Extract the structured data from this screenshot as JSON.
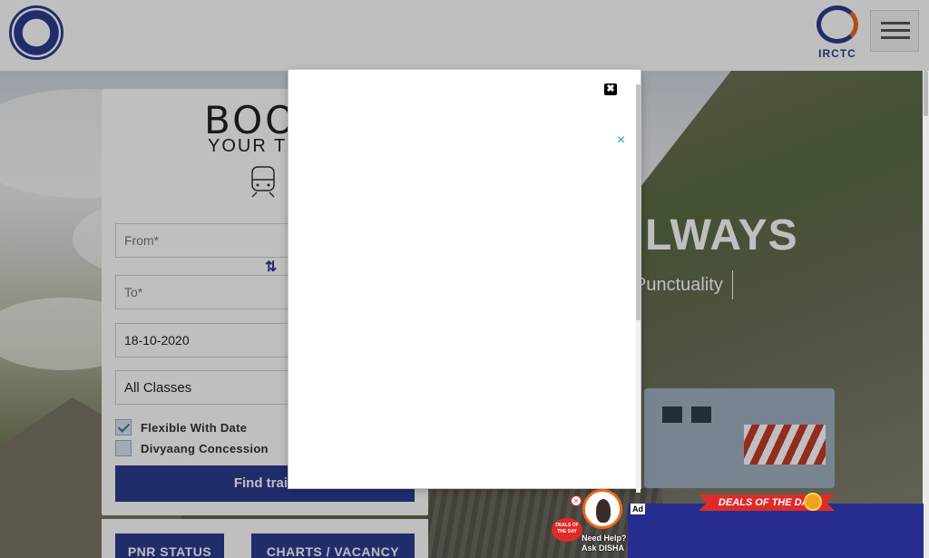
{
  "header": {
    "left_logo": "indian-railways-logo",
    "right_logo_text": "IRCTC",
    "menu_icon": "hamburger-icon"
  },
  "hero": {
    "title_partial": "LWAYS",
    "subtitle_partial": "Punctuality"
  },
  "booking": {
    "title_partial": "BOO",
    "subtitle_partial": "YOUR TIC",
    "from_placeholder": "From*",
    "to_placeholder": "To*",
    "swap_icon": "⇅",
    "date_value": "18-10-2020",
    "class_value": "All Classes",
    "flexible_label": "Flexible With Date",
    "flexible_checked": true,
    "divyaang_label": "Divyaang Concession",
    "divyaang_checked": false,
    "find_button_partial": "Find train"
  },
  "bottom_buttons": {
    "pnr": "PNR STATUS",
    "charts": "CHARTS / VACANCY"
  },
  "modal": {
    "close_glyph": "✖",
    "ad_close_glyph": "×"
  },
  "ad": {
    "tag": "Ad",
    "deals_title": "DEALS OF THE DAY",
    "deals_badge_text": "DEALS OF THE DAY",
    "disha_line1": "Need Help?",
    "disha_line2": "Ask DISHA",
    "close_glyph": "×"
  },
  "colors": {
    "brand_blue": "#2c3b8f",
    "ad_blue": "#272d8f",
    "deals_red": "#e02a2a"
  }
}
